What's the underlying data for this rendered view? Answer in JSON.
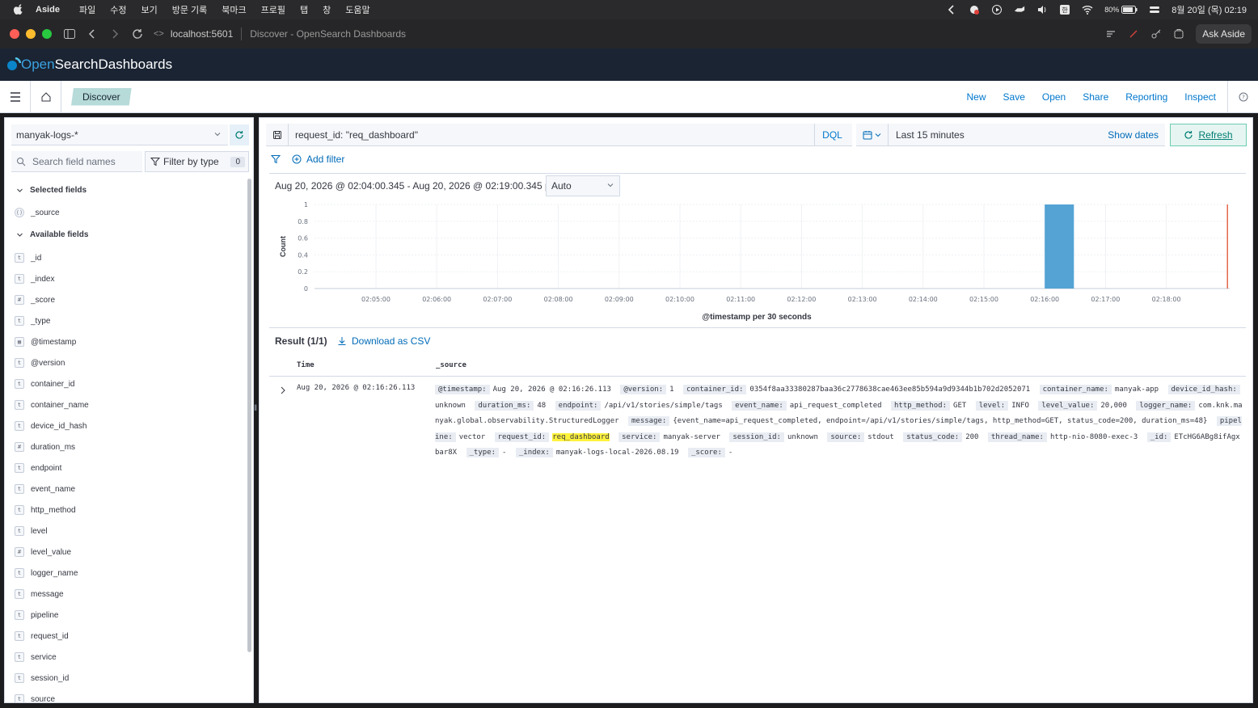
{
  "menubar": {
    "app": "Aside",
    "items": [
      "파일",
      "수정",
      "보기",
      "방문 기록",
      "북마크",
      "프로필",
      "탭",
      "창",
      "도움말"
    ],
    "battery": "80%",
    "clock": "8월 20일 (목) 02:19"
  },
  "browser": {
    "url": "localhost:5601",
    "page_title": "Discover - OpenSearch Dashboards",
    "ask_button": "Ask Aside"
  },
  "osd": {
    "logo_a": "Open",
    "logo_b": "Search",
    "logo_c": " Dashboards"
  },
  "appbar": {
    "breadcrumb": "Discover",
    "nav": {
      "new": "New",
      "save": "Save",
      "open": "Open",
      "share": "Share",
      "reporting": "Reporting",
      "inspect": "Inspect"
    }
  },
  "sidebar": {
    "index_pattern": "manyak-logs-*",
    "search_placeholder": "Search field names",
    "filter_by_type": "Filter by type",
    "filter_count": "0",
    "selected_title": "Selected fields",
    "selected": [
      {
        "type": "src",
        "name": "_source"
      }
    ],
    "available_title": "Available fields",
    "fields": [
      {
        "type": "t",
        "name": "_id"
      },
      {
        "type": "t",
        "name": "_index"
      },
      {
        "type": "#",
        "name": "_score"
      },
      {
        "type": "t",
        "name": "_type"
      },
      {
        "type": "date",
        "name": "@timestamp"
      },
      {
        "type": "t",
        "name": "@version"
      },
      {
        "type": "t",
        "name": "container_id"
      },
      {
        "type": "t",
        "name": "container_name"
      },
      {
        "type": "t",
        "name": "device_id_hash"
      },
      {
        "type": "#",
        "name": "duration_ms"
      },
      {
        "type": "t",
        "name": "endpoint"
      },
      {
        "type": "t",
        "name": "event_name"
      },
      {
        "type": "t",
        "name": "http_method"
      },
      {
        "type": "t",
        "name": "level"
      },
      {
        "type": "#",
        "name": "level_value"
      },
      {
        "type": "t",
        "name": "logger_name"
      },
      {
        "type": "t",
        "name": "message"
      },
      {
        "type": "t",
        "name": "pipeline"
      },
      {
        "type": "t",
        "name": "request_id"
      },
      {
        "type": "t",
        "name": "service"
      },
      {
        "type": "t",
        "name": "session_id"
      },
      {
        "type": "t",
        "name": "source"
      }
    ]
  },
  "query": {
    "text": "request_id: \"req_dashboard\"",
    "language": "DQL",
    "time_range": "Last 15 minutes",
    "show_dates": "Show dates",
    "refresh": "Refresh",
    "add_filter": "Add filter"
  },
  "histogram": {
    "range_text": "Aug 20, 2026 @ 02:04:00.345 - Aug 20, 2026 @ 02:19:00.345 per",
    "interval": "Auto",
    "x_label": "@timestamp per 30 seconds"
  },
  "chart_data": {
    "type": "bar",
    "xlabel": "@timestamp per 30 seconds",
    "ylabel": "Count",
    "ylim": [
      0,
      1
    ],
    "yticks": [
      "0",
      "0.2",
      "0.4",
      "0.6",
      "0.8",
      "1"
    ],
    "xticks": [
      "02:05:00",
      "02:06:00",
      "02:07:00",
      "02:08:00",
      "02:09:00",
      "02:10:00",
      "02:11:00",
      "02:12:00",
      "02:13:00",
      "02:14:00",
      "02:15:00",
      "02:16:00",
      "02:17:00",
      "02:18:00"
    ],
    "series": [
      {
        "x": [
          "02:16:00"
        ],
        "values": [
          1
        ]
      }
    ],
    "bar_color": "#54a3d4",
    "now_marker": "02:19:00.345",
    "grid": true
  },
  "results": {
    "title": "Result (1/1)",
    "download": "Download as CSV",
    "col_time": "Time",
    "col_source": "_source",
    "rows": [
      {
        "time": "Aug 20, 2026 @ 02:16:26.113",
        "fields": [
          {
            "k": "@timestamp:",
            "v": "Aug 20, 2026 @ 02:16:26.113"
          },
          {
            "k": "@version:",
            "v": "1"
          },
          {
            "k": "container_id:",
            "v": "0354f8aa33380287baa36c2778638cae463ee85b594a9d9344b1b702d2052071"
          },
          {
            "k": "container_name:",
            "v": "manyak-app"
          },
          {
            "k": "device_id_hash:",
            "v": "unknown"
          },
          {
            "k": "duration_ms:",
            "v": "48"
          },
          {
            "k": "endpoint:",
            "v": "/api/v1/stories/simple/tags"
          },
          {
            "k": "event_name:",
            "v": "api_request_completed"
          },
          {
            "k": "http_method:",
            "v": "GET"
          },
          {
            "k": "level:",
            "v": "INFO"
          },
          {
            "k": "level_value:",
            "v": "20,000"
          },
          {
            "k": "logger_name:",
            "v": "com.knk.manyak.global.observability.StructuredLogger"
          },
          {
            "k": "message:",
            "v": "{event_name=api_request_completed, endpoint=/api/v1/stories/simple/tags, http_method=GET, status_code=200, duration_ms=48}"
          },
          {
            "k": "pipeline:",
            "v": "vector"
          },
          {
            "k": "request_id:",
            "v": "req_dashboard",
            "highlight": true
          },
          {
            "k": "service:",
            "v": "manyak-server"
          },
          {
            "k": "session_id:",
            "v": "unknown"
          },
          {
            "k": "source:",
            "v": "stdout"
          },
          {
            "k": "status_code:",
            "v": "200"
          },
          {
            "k": "thread_name:",
            "v": "http-nio-8080-exec-3"
          },
          {
            "k": "_id:",
            "v": "ETcHG6ABg8ifAgxbar8X"
          },
          {
            "k": "_type:",
            "v": "-"
          },
          {
            "k": "_index:",
            "v": "manyak-logs-local-2026.08.19"
          },
          {
            "k": "_score:",
            "v": "-"
          }
        ]
      }
    ]
  }
}
